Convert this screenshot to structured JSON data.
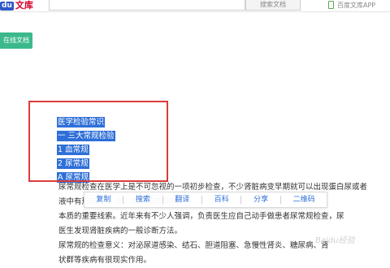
{
  "header": {
    "logo_du": "du",
    "logo_wenku": "文库",
    "search_placeholder": "",
    "search_button": "搜索文档",
    "app_link": "百度文库APP"
  },
  "action_button": "在线文档",
  "selected_lines": [
    "医学检验常识",
    "一 三大常规检验",
    "1 血常规",
    "2 尿常规",
    "A 尿常规"
  ],
  "paragraphs": [
    "尿常规检查在医学上是不可忽视的一项初步检查，不少肾脏病变早期就可以出现蛋白尿或者",
    "液中有形成分。                                   症，亦常是提供疾",
    "本质的重要线索。近年来有不少人强调，负责医生应自己动手做患者尿常规检查，尿",
    "医生发现肾脏疾病的一般诊断方法。",
    "    尿常规的检查意义：对泌尿道感染、结石、胆道阻塞、急慢性肾炎、糖尿病、肾",
    "状群等疾病有很现实作用。"
  ],
  "context_toolbar": {
    "items": [
      "复制",
      "搜索",
      "翻译",
      "百科",
      "分享",
      "二维码"
    ]
  },
  "watermark": "Baidu经验",
  "colors": {
    "selection": "#2e6fd8",
    "red_outline": "#d93c3c",
    "green_button": "#3cb98c",
    "toolbar_text": "#2e6fd8"
  }
}
